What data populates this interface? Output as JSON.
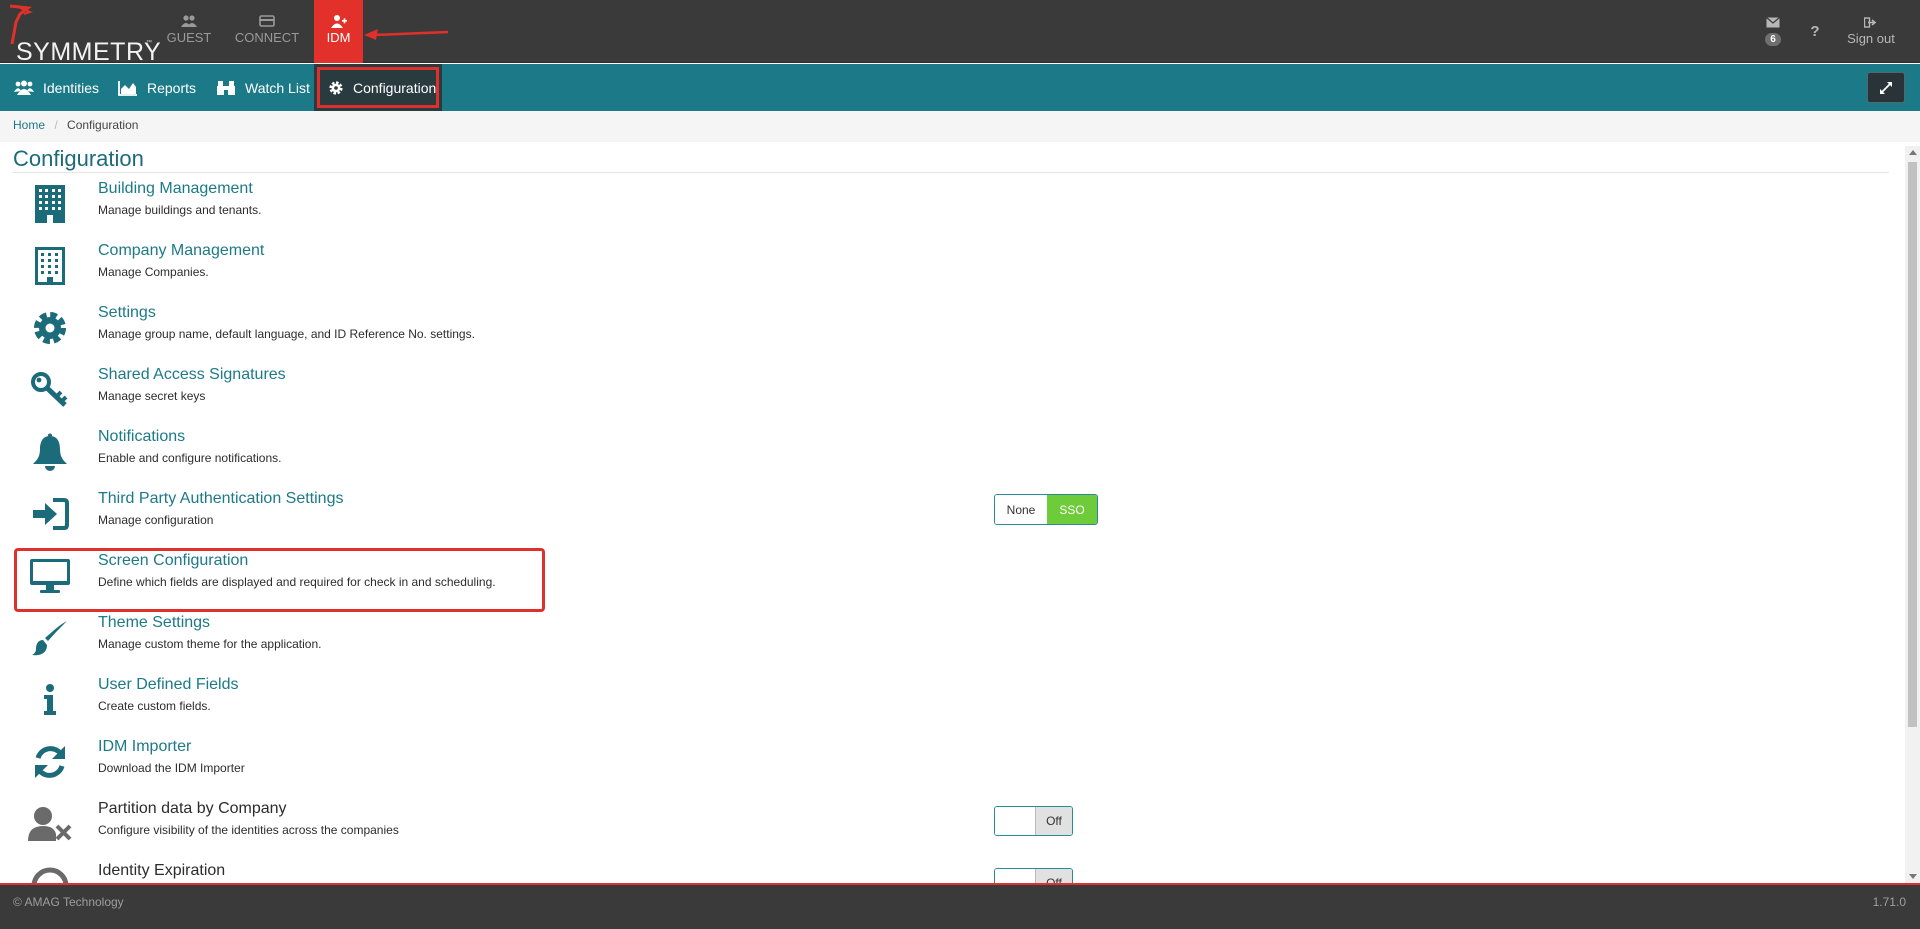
{
  "logo": {
    "text": "SYMMETRY",
    "tm": "™"
  },
  "top_nav": [
    {
      "label": "GUEST",
      "icon": "users-icon"
    },
    {
      "label": "CONNECT",
      "icon": "card-icon"
    },
    {
      "label": "IDM",
      "icon": "user-add-icon",
      "active": true
    }
  ],
  "utility": {
    "messages_count": "6",
    "help_label": "?",
    "sign_out_label": "Sign out"
  },
  "sub_nav": [
    {
      "label": "Identities",
      "icon": "users-icon"
    },
    {
      "label": "Reports",
      "icon": "area-chart-icon"
    },
    {
      "label": "Watch List",
      "icon": "binoculars-icon"
    },
    {
      "label": "Configuration",
      "icon": "gear-icon",
      "selected": true
    }
  ],
  "breadcrumb": {
    "home": "Home",
    "separator": "/",
    "current": "Configuration"
  },
  "page_title": "Configuration",
  "items": [
    {
      "name": "Building Management",
      "desc": "Manage buildings and tenants.",
      "icon": "building-icon"
    },
    {
      "name": "Company Management",
      "desc": "Manage Companies.",
      "icon": "building-outline-icon"
    },
    {
      "name": "Settings",
      "desc": "Manage group name, default language, and ID Reference No. settings.",
      "icon": "gear-icon"
    },
    {
      "name": "Shared Access Signatures",
      "desc": "Manage secret keys",
      "icon": "key-icon"
    },
    {
      "name": "Notifications",
      "desc": "Enable and configure notifications.",
      "icon": "bell-icon"
    },
    {
      "name": "Third Party Authentication Settings",
      "desc": "Manage configuration",
      "icon": "sign-in-icon",
      "control": {
        "options": [
          "None",
          "SSO"
        ],
        "selected": "SSO"
      }
    },
    {
      "name": "Screen Configuration",
      "desc": "Define which fields are displayed and required for check in and scheduling.",
      "icon": "monitor-icon"
    },
    {
      "name": "Theme Settings",
      "desc": "Manage custom theme for the application.",
      "icon": "paintbrush-icon"
    },
    {
      "name": "User Defined Fields",
      "desc": "Create custom fields.",
      "icon": "info-icon"
    },
    {
      "name": "IDM Importer",
      "desc": "Download the IDM Importer",
      "icon": "refresh-icon"
    },
    {
      "name": "Partition data by Company",
      "desc": "Configure visibility of the identities across the companies",
      "icon": "user-times-icon",
      "control": {
        "state": "Off"
      }
    },
    {
      "name": "Identity Expiration",
      "desc": "",
      "icon": "clock-icon",
      "control": {
        "state": "Off"
      }
    }
  ],
  "footer": {
    "copyright": "© AMAG Technology",
    "version": "1.71.0"
  },
  "colors": {
    "accent": "#1c7a88",
    "brand_red": "#e2312a",
    "topbar": "#3a3a3a",
    "sso_green": "#6ecc3a"
  }
}
